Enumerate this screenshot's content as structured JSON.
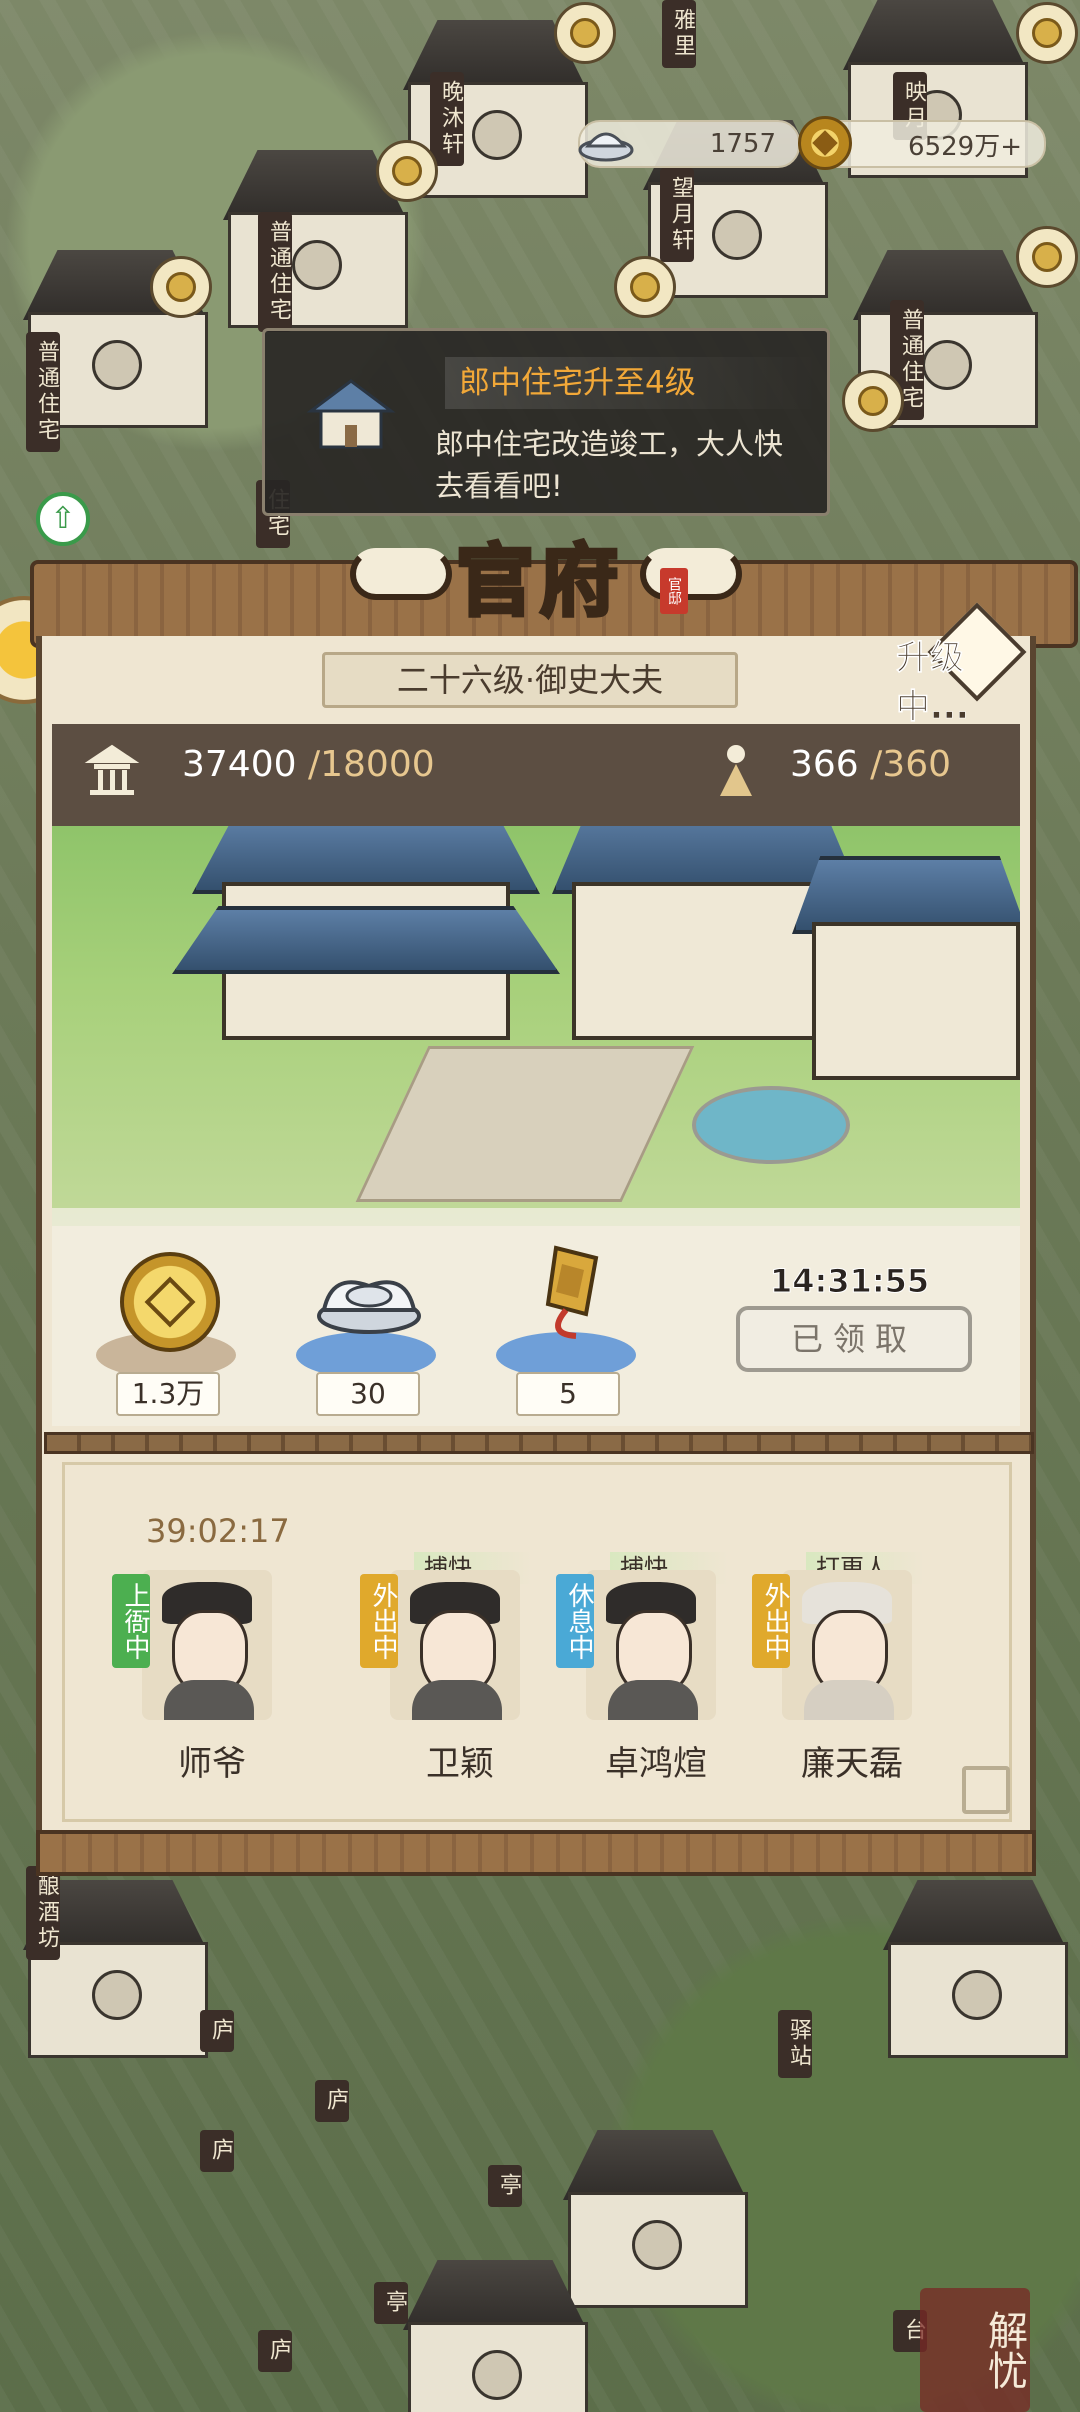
{
  "resources": {
    "silver": "1757",
    "gold": "6529万+"
  },
  "notification": {
    "title": "郎中住宅升至4级",
    "message": "郎中住宅改造竣工，大人快去看看吧!"
  },
  "map_labels": {
    "top_left_1": "晚沐轩",
    "top_mid": "雅里",
    "top_right": "映月",
    "mid": "望月轩",
    "left_1": "普通住宅",
    "left_2": "普通住宅",
    "right_1": "普通住宅",
    "left_small": "住宅",
    "brewery": "酿酒坊",
    "lu_1": "庐",
    "lu_2": "庐",
    "lu_3": "庐",
    "lu_4": "庐",
    "post": "驿站",
    "ting_1": "亭",
    "ting_2": "亭",
    "tai": "台"
  },
  "panel": {
    "title": "官府",
    "seal": "官邸",
    "rank": "二十六级·御史大夫",
    "upgrade_status": "升级中...",
    "stat_prosperity": "37400",
    "stat_prosperity_max": "/18000",
    "stat_population": "366",
    "stat_population_max": "/360",
    "reward_timer": "14:31:55",
    "claim_button": "已领取",
    "rewards": [
      {
        "icon": "copper-coin-icon",
        "amount": "1.3万"
      },
      {
        "icon": "silver-ingot-icon",
        "amount": "30"
      },
      {
        "icon": "token-icon",
        "amount": "5"
      }
    ],
    "staff_timer": "39:02:17",
    "staff": [
      {
        "name": "师爷",
        "status": "上衙中",
        "role": "",
        "status_color": "#4caf50"
      },
      {
        "name": "卫颖",
        "status": "外出中",
        "role": "捕快",
        "status_color": "#e0a92c"
      },
      {
        "name": "卓鸿煊",
        "status": "休息中",
        "role": "捕快",
        "status_color": "#4aa9d6"
      },
      {
        "name": "廉天磊",
        "status": "外出中",
        "role": "打更人",
        "status_color": "#e0a92c"
      }
    ]
  },
  "corner_button": "解忧"
}
